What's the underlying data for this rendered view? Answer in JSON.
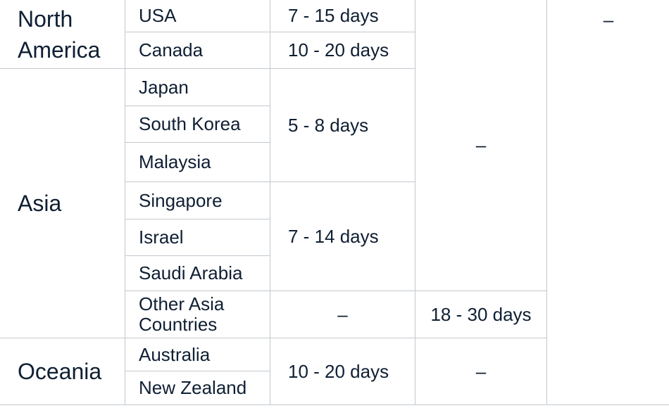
{
  "regions": [
    {
      "name": "North America"
    },
    {
      "name": "Asia"
    },
    {
      "name": "Oceania"
    }
  ],
  "countries": [
    "USA",
    "Canada",
    "Japan",
    "South Korea",
    "Malaysia",
    "Singapore",
    "Israel",
    "Saudi Arabia",
    "Other Asia Countries",
    "Australia",
    "New Zealand"
  ],
  "col3": [
    "7 - 15 days",
    "10 - 20 days",
    "5 - 8 days",
    "7 - 14 days",
    "–",
    "10 - 20 days"
  ],
  "col4": [
    "–",
    "18 - 30 days",
    "–"
  ],
  "col5": [
    "–"
  ]
}
